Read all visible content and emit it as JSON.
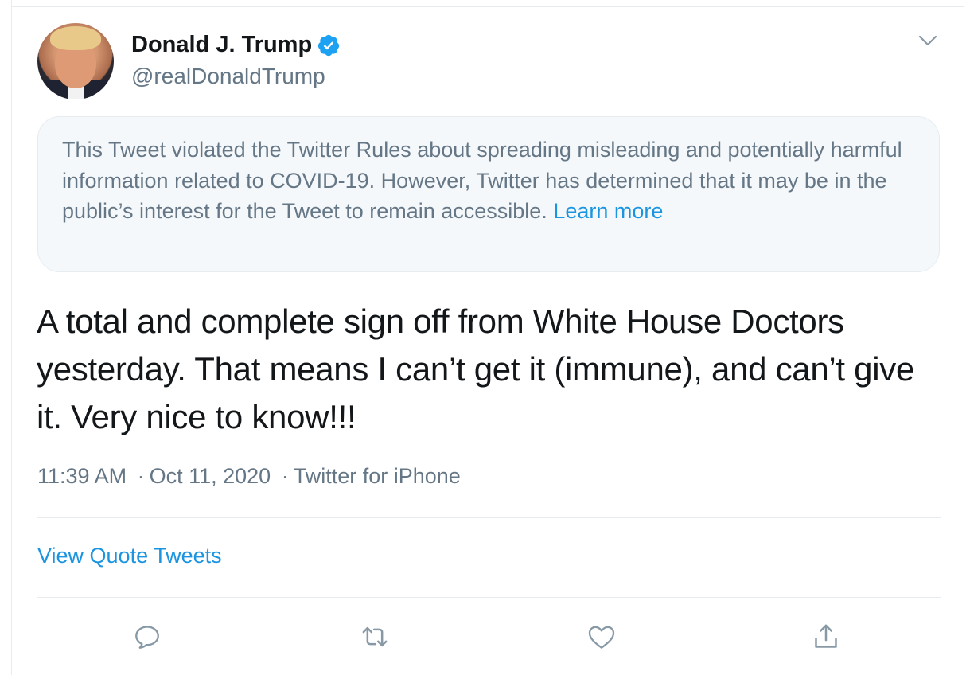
{
  "author": {
    "display_name": "Donald J. Trump",
    "handle": "@realDonaldTrump",
    "verified_icon": "verified-badge-icon",
    "avatar": "profile-photo"
  },
  "notice": {
    "text": "This Tweet violated the Twitter Rules about spreading misleading and potentially harmful information related to COVID-19. However, Twitter has determined that it may be in the public’s interest for the Tweet to remain accessible.",
    "link_label": "Learn more"
  },
  "tweet": {
    "text": "A total and complete sign off from White House Doctors yesterday. That means I can’t get it (immune), and can’t give it. Very nice to know!!!"
  },
  "meta": {
    "time": "11:39 AM",
    "separator": "·",
    "date": "Oct 11, 2020",
    "source": "Twitter for iPhone"
  },
  "quote_tweets_label": "View Quote Tweets",
  "actions": {
    "icons": [
      "reply-icon",
      "retweet-icon",
      "like-icon",
      "share-icon"
    ]
  },
  "colors": {
    "accent": "#1b95e0",
    "text": "#14171a",
    "secondary": "#657786",
    "border": "#e6ecf0",
    "notice_bg": "#f5f8fa"
  }
}
